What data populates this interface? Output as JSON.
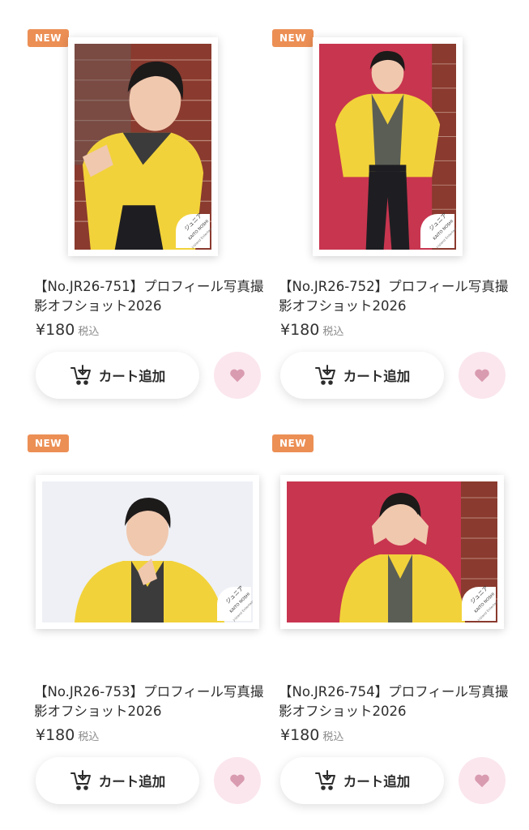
{
  "products": [
    {
      "badge": "NEW",
      "title": "【No.JR26-751】プロフィール写真撮影オフショット2026",
      "price": "¥180",
      "tax_label": "税込",
      "cart_label": "カート追加",
      "stamp": [
        "ジュニア",
        "KAITO NOSHI",
        "J-Island Entertainment"
      ]
    },
    {
      "badge": "NEW",
      "title": "【No.JR26-752】プロフィール写真撮影オフショット2026",
      "price": "¥180",
      "tax_label": "税込",
      "cart_label": "カート追加",
      "stamp": [
        "ジュニア",
        "KAITO NOSHI",
        "J-Island Entertainment"
      ]
    },
    {
      "badge": "NEW",
      "title": "【No.JR26-753】プロフィール写真撮影オフショット2026",
      "price": "¥180",
      "tax_label": "税込",
      "cart_label": "カート追加",
      "stamp": [
        "ジュニア",
        "KAITO NOSHI",
        "J-Island Entertainment"
      ]
    },
    {
      "badge": "NEW",
      "title": "【No.JR26-754】プロフィール写真撮影オフショット2026",
      "price": "¥180",
      "tax_label": "税込",
      "cart_label": "カート追加",
      "stamp": [
        "ジュニア",
        "KAITO NOSHI",
        "J-Island Entertainment"
      ]
    }
  ],
  "colors": {
    "badge": "#ec8f55",
    "favorite_bg": "#fbe6ee",
    "favorite_heart": "#d99bb0",
    "jacket": "#f2d23a",
    "brick": "#8a3a2e",
    "red_wall": "#c8354f"
  },
  "icons": {
    "cart": "cart-icon",
    "favorite": "heart-icon"
  }
}
